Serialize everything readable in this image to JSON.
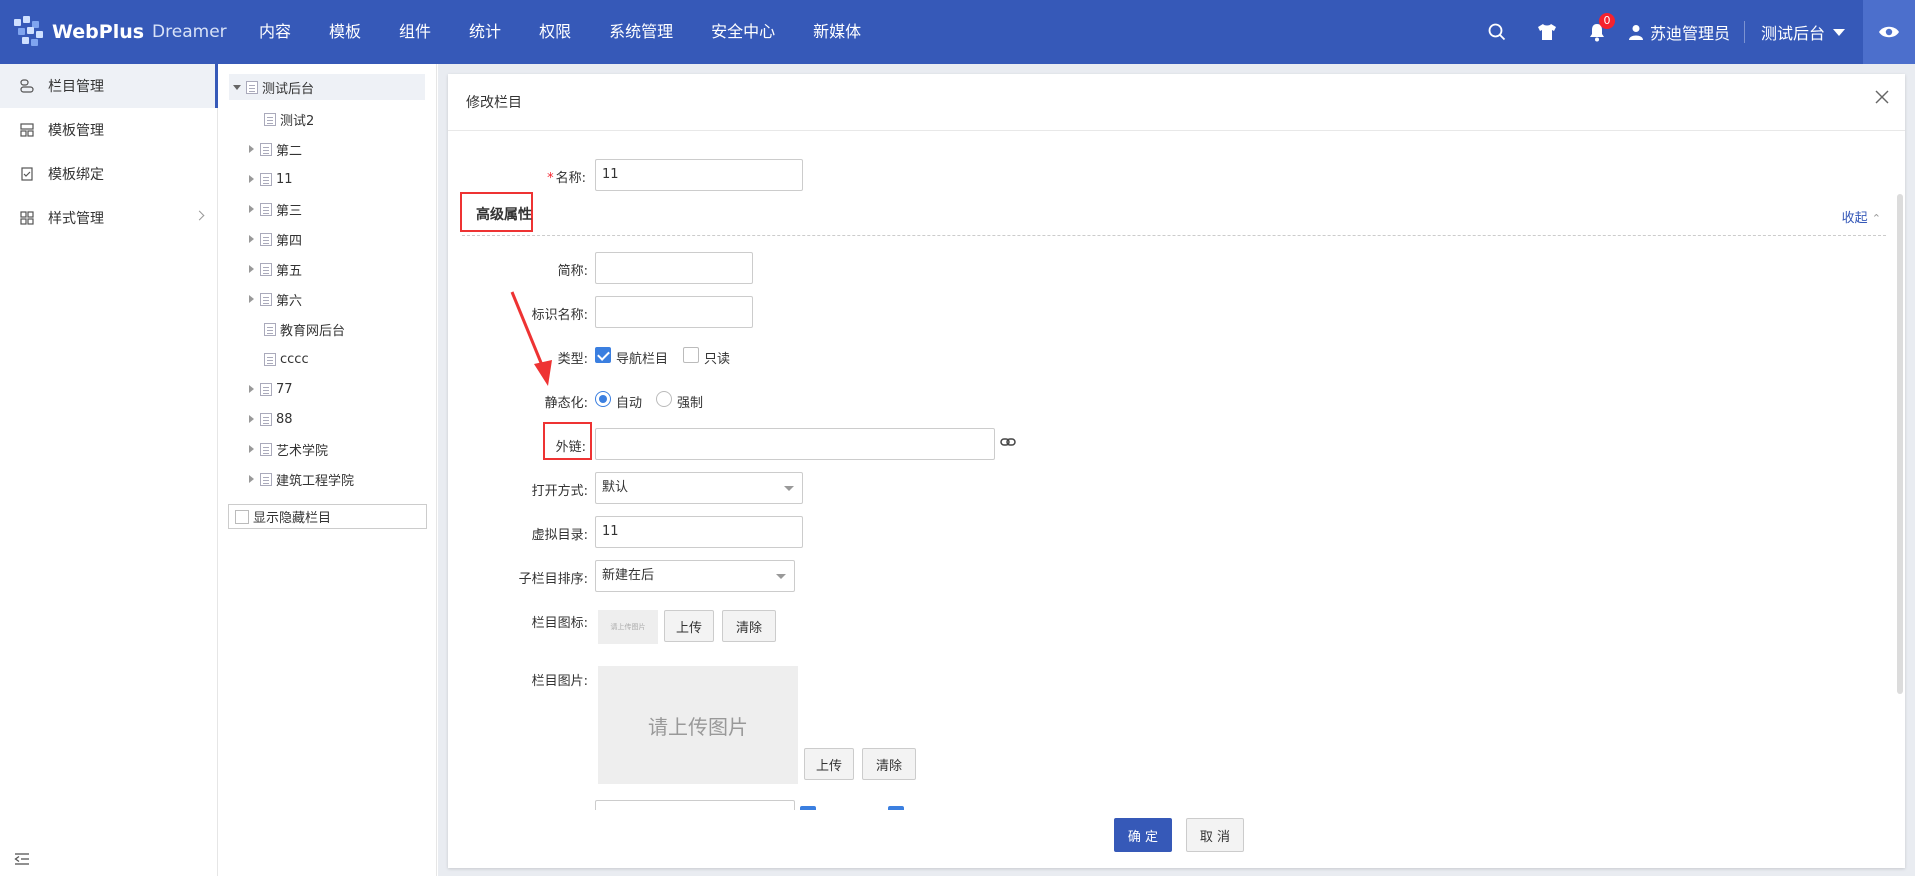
{
  "app": {
    "title": "WebPlus",
    "subtitle": "Dreamer"
  },
  "nav": [
    "内容",
    "模板",
    "组件",
    "统计",
    "权限",
    "系统管理",
    "安全中心",
    "新媒体"
  ],
  "topbar": {
    "notifications": "0",
    "user_name": "苏迪管理员",
    "site_name": "测试后台"
  },
  "left_menu": [
    {
      "label": "栏目管理",
      "icon": "column-manage-icon",
      "active": true
    },
    {
      "label": "模板管理",
      "icon": "template-manage-icon"
    },
    {
      "label": "模板绑定",
      "icon": "template-bind-icon"
    },
    {
      "label": "样式管理",
      "icon": "style-manage-icon",
      "has_children": true
    }
  ],
  "tree": {
    "root": "测试后台",
    "items": [
      {
        "label": "测试2",
        "expandable": false
      },
      {
        "label": "第二",
        "expandable": true
      },
      {
        "label": "11",
        "expandable": true
      },
      {
        "label": "第三",
        "expandable": true
      },
      {
        "label": "第四",
        "expandable": true
      },
      {
        "label": "第五",
        "expandable": true
      },
      {
        "label": "第六",
        "expandable": true
      },
      {
        "label": "教育网后台",
        "expandable": false
      },
      {
        "label": "cccc",
        "expandable": false
      },
      {
        "label": "77",
        "expandable": true
      },
      {
        "label": "88",
        "expandable": true
      },
      {
        "label": "艺术学院",
        "expandable": true
      },
      {
        "label": "建筑工程学院",
        "expandable": true
      }
    ],
    "show_hidden_label": "显示隐藏栏目"
  },
  "dialog": {
    "title": "修改栏目",
    "name_label": "名称:",
    "name_value": "11",
    "advanced_title": "高级属性",
    "collapse_label": "收起",
    "short_name_label": "简称:",
    "short_name_value": "",
    "ident_label": "标识名称:",
    "ident_value": "",
    "type_label": "类型:",
    "type_nav_label": "导航栏目",
    "type_nav_checked": true,
    "type_readonly_label": "只读",
    "type_readonly_checked": false,
    "static_label": "静态化:",
    "static_auto_label": "自动",
    "static_force_label": "强制",
    "static_selected": "自动",
    "link_label": "外链:",
    "link_value": "",
    "open_mode_label": "打开方式:",
    "open_mode_value": "默认",
    "vdir_label": "虚拟目录:",
    "vdir_value": "11",
    "sort_label": "子栏目排序:",
    "sort_value": "新建在后",
    "icon_label": "栏目图标:",
    "icon_placeholder": "请上传图片",
    "upload_label": "上传",
    "clear_label": "清除",
    "image_label": "栏目图片:",
    "image_placeholder": "请上传图片",
    "ok_label": "确 定",
    "cancel_label": "取 消"
  }
}
